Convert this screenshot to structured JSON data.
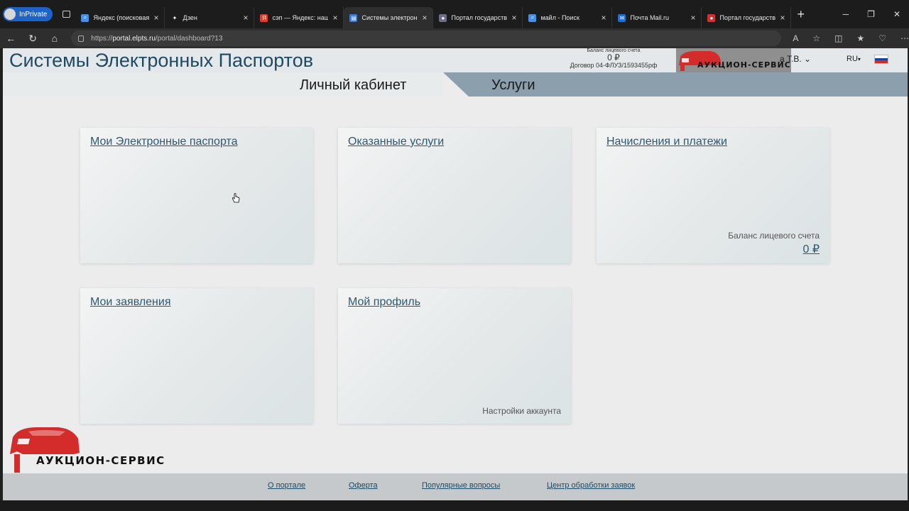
{
  "browser": {
    "inprivate_label": "InPrivate",
    "tabs": [
      {
        "title": "Яндекс (поисковая с",
        "fav": "search-icon",
        "fav_color": "#4a90e2"
      },
      {
        "title": "Дзен",
        "fav": "zen-icon",
        "fav_color": "#1c1c1c"
      },
      {
        "title": "сэп — Яндекс: нашл",
        "fav": "yandex-icon",
        "fav_color": "#e03a2b"
      },
      {
        "title": "Системы электронны",
        "fav": "page-icon",
        "fav_color": "#3b7bd4",
        "active": true
      },
      {
        "title": "Портал государствен",
        "fav": "globe-icon",
        "fav_color": "#6d6d8a"
      },
      {
        "title": "майл - Поиск",
        "fav": "search-icon",
        "fav_color": "#4a90e2"
      },
      {
        "title": "Почта Mail.ru",
        "fav": "mail-icon",
        "fav_color": "#1f6fd1"
      },
      {
        "title": "Портал государствен",
        "fav": "flag-icon",
        "fav_color": "#cc3333"
      }
    ],
    "url_prefix": "https://",
    "url_host": "portal.elpts.ru",
    "url_path": "/portal/dashboard?13"
  },
  "header": {
    "site_title": "Системы Электронных Паспортов",
    "balance_label": "Баланс лицевого счета",
    "balance_value": "0 ₽",
    "contract": "Договор 04-ФЛУЗ/1593455рф",
    "user_name": "а Т.В.",
    "lang": "RU"
  },
  "nav": {
    "cabinet": "Личный кабинет",
    "services": "Услуги"
  },
  "cards": {
    "passports": {
      "title": "Мои Электронные паспорта"
    },
    "services": {
      "title": "Оказанные услуги"
    },
    "payments": {
      "title": "Начисления и платежи",
      "balance_label": "Баланс лицевого счета",
      "balance_value": "0 ₽"
    },
    "applications": {
      "title": "Мои заявления"
    },
    "profile": {
      "title": "Мой профиль",
      "settings": "Настройки аккаунта"
    }
  },
  "watermark": {
    "text": "АУКЦИОН-СЕРВИС",
    "color": "#d42b2b"
  },
  "footer": {
    "about": "О портале",
    "offer": "Оферта",
    "faq": "Популярные вопросы",
    "center": "Центр обработки заявок"
  }
}
